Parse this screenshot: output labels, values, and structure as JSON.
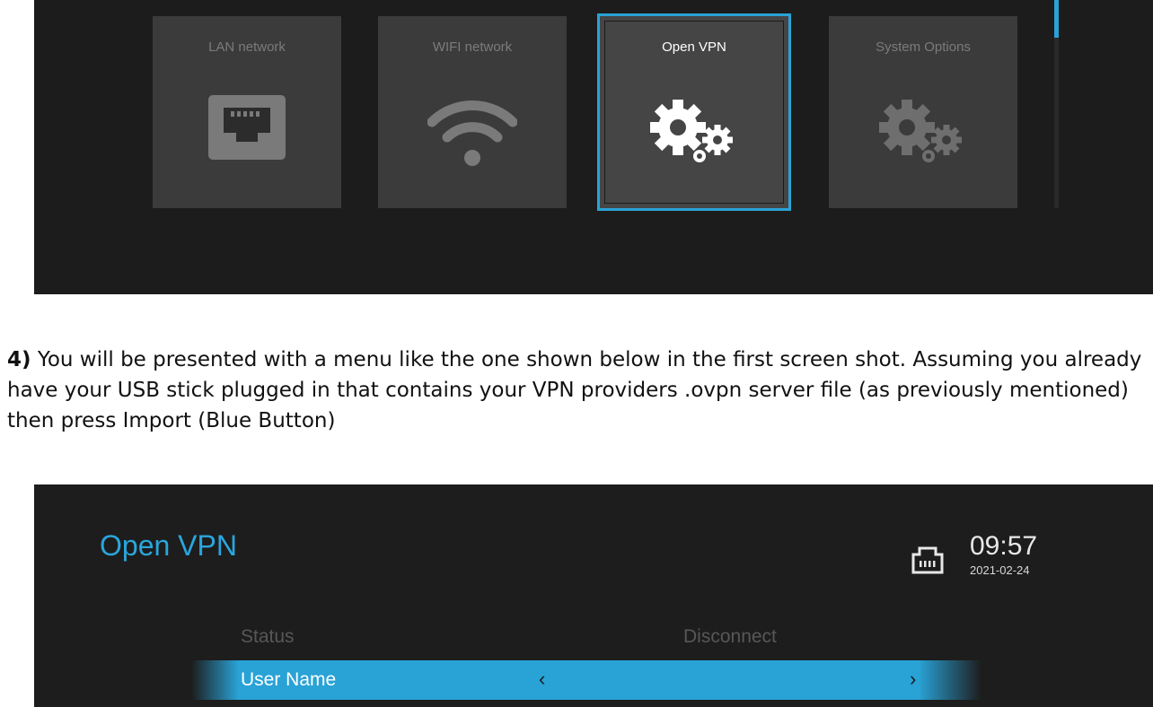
{
  "top_screen": {
    "tiles": [
      {
        "label": "LAN network",
        "icon": "ethernet-port-icon",
        "selected": false
      },
      {
        "label": "WIFI network",
        "icon": "wifi-icon",
        "selected": false
      },
      {
        "label": "Open VPN",
        "icon": "gears-icon",
        "selected": true
      },
      {
        "label": "System Options",
        "icon": "gears-icon",
        "selected": false
      }
    ],
    "accent_color": "#29a3d6"
  },
  "instruction": {
    "step": "4)",
    "text": " You will be presented with a menu like the one shown below in the first screen shot. Assuming you already have your USB stick plugged in that contains your VPN providers .ovpn server file (as previously mentioned) then press Import (Blue Button)"
  },
  "bottom_screen": {
    "title": "Open VPN",
    "time": "09:57",
    "date": "2021-02-24",
    "status_label": "Status",
    "status_value": "Disconnect",
    "selected_row_label": "User Name",
    "arrow_left": "‹",
    "arrow_right": "›",
    "title_color": "#2aa6dd"
  }
}
